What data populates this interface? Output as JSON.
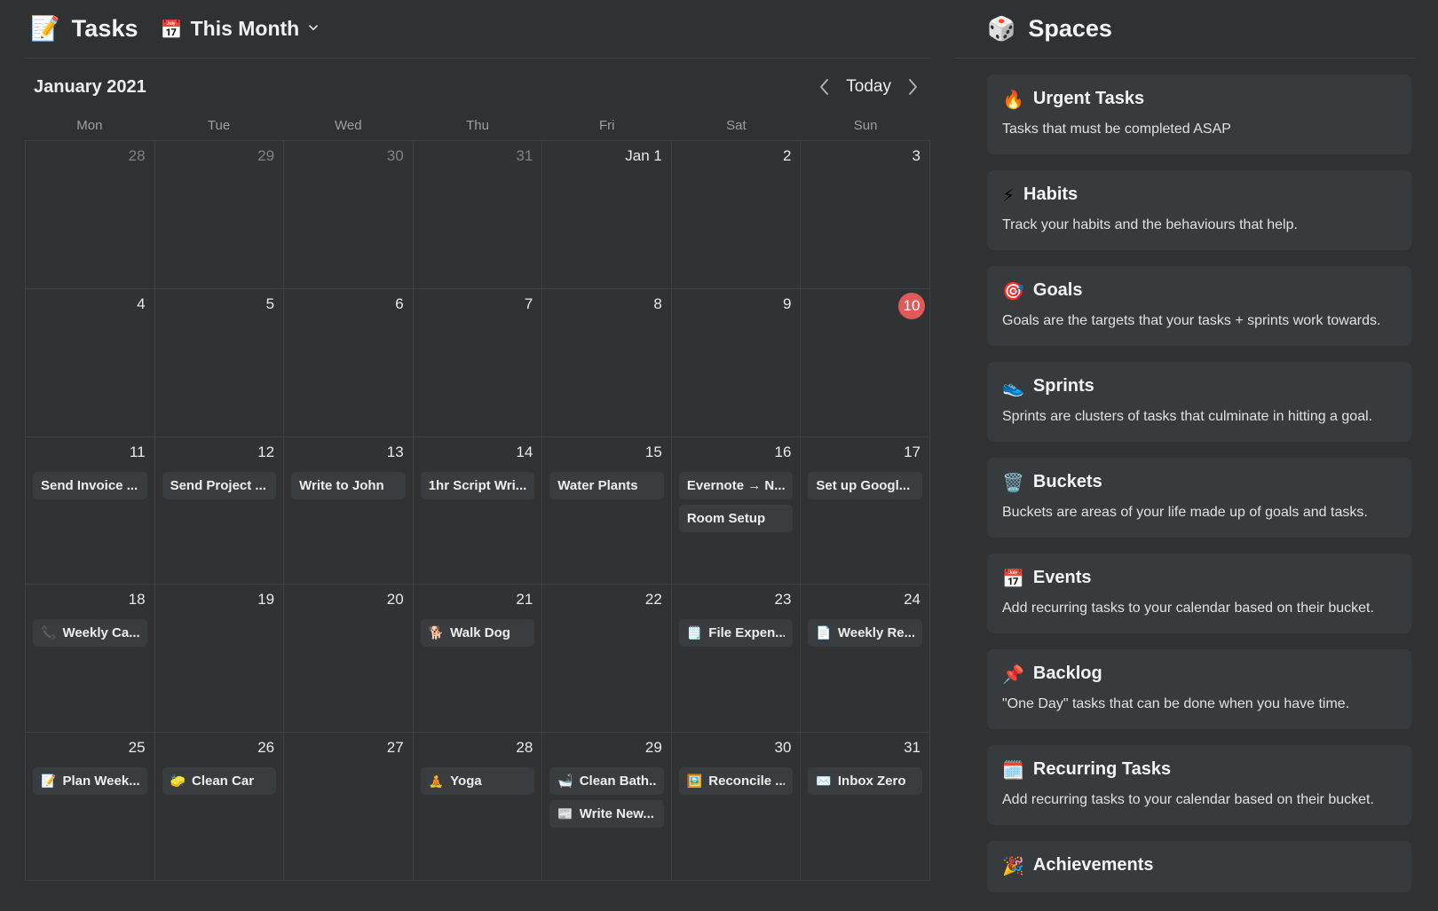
{
  "header": {
    "app_emoji": "📝",
    "app_title": "Tasks",
    "scope_icon": "📅",
    "scope_label": "This Month",
    "caret_icon": "chevron-down-icon"
  },
  "calendar": {
    "month_label": "January 2021",
    "today_label": "Today",
    "prev_icon": "chevron-left-icon",
    "next_icon": "chevron-right-icon",
    "weekdays": [
      "Mon",
      "Tue",
      "Wed",
      "Thu",
      "Fri",
      "Sat",
      "Sun"
    ],
    "accent_today": "#e05a5a",
    "weeks": [
      [
        {
          "num": "28",
          "muted": true,
          "today": false,
          "tasks": []
        },
        {
          "num": "29",
          "muted": true,
          "today": false,
          "tasks": []
        },
        {
          "num": "30",
          "muted": true,
          "today": false,
          "tasks": []
        },
        {
          "num": "31",
          "muted": true,
          "today": false,
          "tasks": []
        },
        {
          "num": "Jan 1",
          "muted": false,
          "today": false,
          "tasks": []
        },
        {
          "num": "2",
          "muted": false,
          "today": false,
          "tasks": []
        },
        {
          "num": "3",
          "muted": false,
          "today": false,
          "tasks": []
        }
      ],
      [
        {
          "num": "4",
          "muted": false,
          "today": false,
          "tasks": []
        },
        {
          "num": "5",
          "muted": false,
          "today": false,
          "tasks": []
        },
        {
          "num": "6",
          "muted": false,
          "today": false,
          "tasks": []
        },
        {
          "num": "7",
          "muted": false,
          "today": false,
          "tasks": []
        },
        {
          "num": "8",
          "muted": false,
          "today": false,
          "tasks": []
        },
        {
          "num": "9",
          "muted": false,
          "today": false,
          "tasks": []
        },
        {
          "num": "10",
          "muted": false,
          "today": true,
          "tasks": []
        }
      ],
      [
        {
          "num": "11",
          "muted": false,
          "today": false,
          "tasks": [
            {
              "emoji": "",
              "text": "Send Invoice ..."
            }
          ]
        },
        {
          "num": "12",
          "muted": false,
          "today": false,
          "tasks": [
            {
              "emoji": "",
              "text": "Send Project ..."
            }
          ]
        },
        {
          "num": "13",
          "muted": false,
          "today": false,
          "tasks": [
            {
              "emoji": "",
              "text": "Write to John"
            }
          ]
        },
        {
          "num": "14",
          "muted": false,
          "today": false,
          "tasks": [
            {
              "emoji": "",
              "text": "1hr Script Wri..."
            }
          ]
        },
        {
          "num": "15",
          "muted": false,
          "today": false,
          "tasks": [
            {
              "emoji": "",
              "text": "Water Plants"
            }
          ]
        },
        {
          "num": "16",
          "muted": false,
          "today": false,
          "tasks": [
            {
              "emoji": "",
              "text": "Evernote → N..."
            },
            {
              "emoji": "",
              "text": "Room Setup"
            }
          ]
        },
        {
          "num": "17",
          "muted": false,
          "today": false,
          "tasks": [
            {
              "emoji": "",
              "text": "Set up Googl..."
            }
          ]
        }
      ],
      [
        {
          "num": "18",
          "muted": false,
          "today": false,
          "tasks": [
            {
              "emoji": "📞",
              "text": "Weekly Ca..."
            }
          ]
        },
        {
          "num": "19",
          "muted": false,
          "today": false,
          "tasks": []
        },
        {
          "num": "20",
          "muted": false,
          "today": false,
          "tasks": []
        },
        {
          "num": "21",
          "muted": false,
          "today": false,
          "tasks": [
            {
              "emoji": "🐕",
              "text": "Walk Dog"
            }
          ]
        },
        {
          "num": "22",
          "muted": false,
          "today": false,
          "tasks": []
        },
        {
          "num": "23",
          "muted": false,
          "today": false,
          "tasks": [
            {
              "emoji": "🗒️",
              "text": "File Expen..."
            }
          ]
        },
        {
          "num": "24",
          "muted": false,
          "today": false,
          "tasks": [
            {
              "emoji": "📄",
              "text": "Weekly Re..."
            }
          ]
        }
      ],
      [
        {
          "num": "25",
          "muted": false,
          "today": false,
          "tasks": [
            {
              "emoji": "📝",
              "text": "Plan Week..."
            }
          ]
        },
        {
          "num": "26",
          "muted": false,
          "today": false,
          "tasks": [
            {
              "emoji": "🧽",
              "text": "Clean Car"
            }
          ]
        },
        {
          "num": "27",
          "muted": false,
          "today": false,
          "tasks": []
        },
        {
          "num": "28",
          "muted": false,
          "today": false,
          "tasks": [
            {
              "emoji": "🧘",
              "text": "Yoga"
            }
          ]
        },
        {
          "num": "29",
          "muted": false,
          "today": false,
          "tasks": [
            {
              "emoji": "🛁",
              "text": "Clean Bath..."
            },
            {
              "emoji": "📰",
              "text": "Write New..."
            }
          ]
        },
        {
          "num": "30",
          "muted": false,
          "today": false,
          "tasks": [
            {
              "emoji": "🖼️",
              "text": "Reconcile ..."
            }
          ]
        },
        {
          "num": "31",
          "muted": false,
          "today": false,
          "tasks": [
            {
              "emoji": "✉️",
              "text": "Inbox Zero"
            }
          ]
        }
      ]
    ]
  },
  "spaces": {
    "panel_emoji": "🎲",
    "panel_title": "Spaces",
    "items": [
      {
        "emoji": "🔥",
        "name": "Urgent Tasks",
        "desc": "Tasks that must be completed ASAP"
      },
      {
        "emoji": "⚡",
        "name": "Habits",
        "desc": "Track your habits and the behaviours that help."
      },
      {
        "emoji": "🎯",
        "name": "Goals",
        "desc": "Goals are the targets that your tasks + sprints work towards."
      },
      {
        "emoji": "👟",
        "name": "Sprints",
        "desc": "Sprints are clusters of tasks that culminate in hitting a goal."
      },
      {
        "emoji": "🗑️",
        "name": "Buckets",
        "desc": "Buckets are areas of your life made up of goals and tasks."
      },
      {
        "emoji": "📅",
        "name": "Events",
        "desc": "Add recurring tasks to your calendar based on their bucket."
      },
      {
        "emoji": "📌",
        "name": "Backlog",
        "desc": "\"One Day\" tasks that can be done when you have time."
      },
      {
        "emoji": "🗓️",
        "name": "Recurring Tasks",
        "desc": "Add recurring tasks to your calendar based on their bucket."
      },
      {
        "emoji": "🎉",
        "name": "Achievements",
        "desc": ""
      }
    ]
  }
}
